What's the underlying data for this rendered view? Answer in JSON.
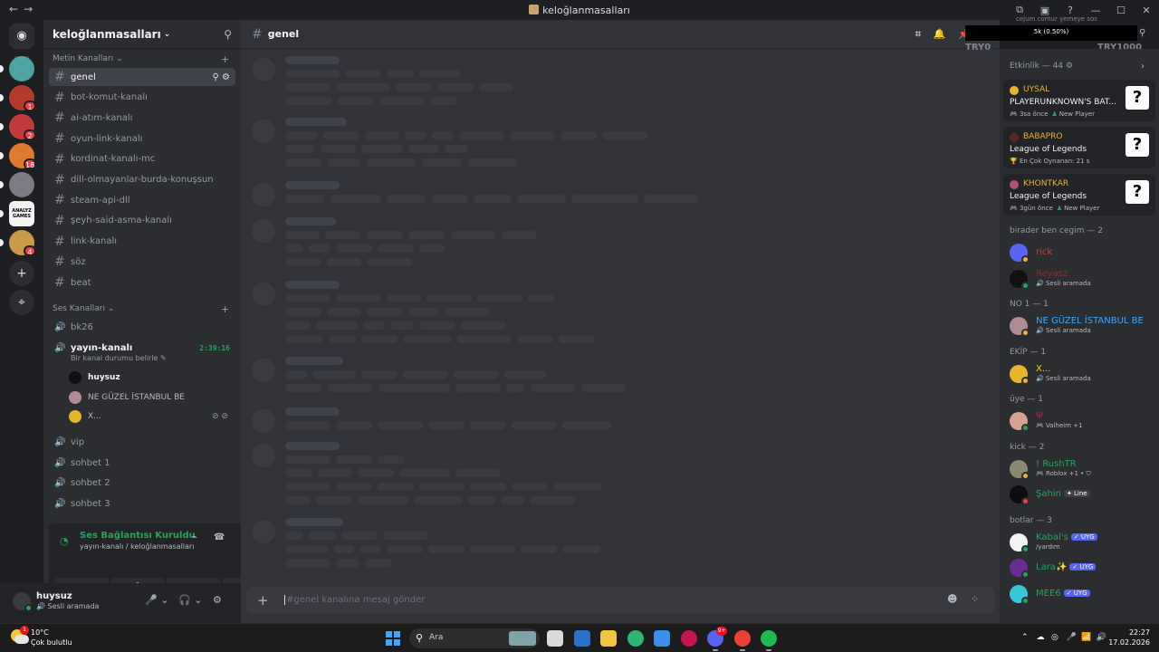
{
  "window": {
    "title": "keloğlanmasalları",
    "nav_back": "←",
    "nav_forward": "→",
    "icons": [
      "inbox-icon",
      "screen-share-icon",
      "help-icon",
      "minimize-icon",
      "maximize-icon",
      "close-icon"
    ],
    "icon_glyphs": [
      "⧉",
      "▣",
      "?",
      "—",
      "☐",
      "✕"
    ]
  },
  "guilds": {
    "home_icon": "discord-logo-icon",
    "home_glyph": "◉",
    "items": [
      {
        "name": "server-1",
        "color": "#4fa3a0",
        "badge": ""
      },
      {
        "name": "server-2",
        "color": "#b23b2c",
        "badge": "1"
      },
      {
        "name": "server-3",
        "color": "#c23a3a",
        "badge": "2"
      },
      {
        "name": "server-4",
        "color": "#e07a2f",
        "badge": "18"
      },
      {
        "name": "server-5",
        "color": "#7c7c84",
        "badge": ""
      },
      {
        "name": "server-6",
        "color": "#f2f2f2",
        "badge": ""
      },
      {
        "name": "server-7",
        "color": "#c99a47",
        "badge": "4"
      }
    ],
    "sixth_label": "ANALYZ GAMES",
    "add_glyph": "+",
    "explore_glyph": "⌖"
  },
  "server": {
    "name": "keloğlanmasalları",
    "chevron": "⌄",
    "add_person_glyph": "⚲"
  },
  "channels": {
    "text_category": "Metin Kanalları",
    "text_category_chev": "⌄",
    "cat_plus": "+",
    "text": [
      "genel",
      "bot-komut-kanalı",
      "ai-atım-kanalı",
      "oyun-link-kanalı",
      "kordinat-kanalı-mc",
      "dill-olmayanlar-burda-konuşsun",
      "steam-api-dll",
      "şeyh-said-asma-kanalı",
      "link-kanalı",
      "söz",
      "beat"
    ],
    "active_tools": "⚲ ⚙",
    "voice_category": "Ses Kanalları",
    "voice_category_chev": "⌄",
    "voice_top": [
      "bk26"
    ],
    "active_voice": {
      "name": "yayın-kanalı",
      "timer": "2:39:16",
      "status": "Bir kanal durumu belirle ✎"
    },
    "voice_users": [
      {
        "name": "huysuz",
        "color": "#101010",
        "bold": true,
        "mute": ""
      },
      {
        "name": "NE GÜZEL İSTANBUL BE",
        "color": "#b08a94",
        "bold": false,
        "mute": ""
      },
      {
        "name": "X...",
        "color": "#e8b52a",
        "bold": false,
        "mute": "⊘ ⊘"
      }
    ],
    "voice_bottom": [
      "vip",
      "sohbet 1",
      "sohbet 2",
      "sohbet 3"
    ]
  },
  "voice_panel": {
    "signal_glyph": "◔",
    "title": "Ses Bağlantısı Kuruldu",
    "subtitle": "yayın-kanalı / keloğlanmasalları",
    "noise_glyph": "⌁",
    "hangup_glyph": "☎",
    "buttons": [
      "⊘",
      "⇪",
      "⁘",
      "✺"
    ]
  },
  "user_panel": {
    "name": "huysuz",
    "status": "🔊 Sesli aramada",
    "mic_glyph": "🎤 ⌄",
    "headset_glyph": "🎧 ⌄",
    "settings_glyph": "⚙"
  },
  "chat": {
    "channel": "genel",
    "header_icons": "⌗ 🔔 📌",
    "placeholder": "#genel kanalına mesaj gönder",
    "plus": "+",
    "emoji_glyph": "☻",
    "apps_glyph": "⁘"
  },
  "overlay": {
    "top_text": "cejum comur yemeye sos",
    "percent": "5k (0.50%)",
    "try_left": "TRY0",
    "try_right": "TRY1000",
    "search_glyph": "⚲"
  },
  "members": {
    "activity_header": "Etkinlik — 44 ⚙",
    "activity_arrow": "›",
    "activities": [
      {
        "name": "UYSAL",
        "dot": "#e8b52a",
        "game": "PLAYERUNKNOWN'S BAT...",
        "meta": "🎮 3sa önce",
        "extra": "New Player",
        "icon": "?"
      },
      {
        "name": "BABAPRO",
        "dot": "#5a2a2a",
        "game": "League of Legends",
        "meta": "🏆 En Çok Oynanan: 21 s",
        "extra": "",
        "icon": "?"
      },
      {
        "name": "KHONTKAR",
        "dot": "#b05070",
        "game": "League of Legends",
        "meta": "🎮 3gün önce",
        "extra": "New Player",
        "icon": "?"
      }
    ],
    "groups": [
      {
        "header": "birader ben cegim — 2",
        "members": [
          {
            "name": "rick",
            "color": "#d13b3b",
            "avatar": "#5865f2",
            "status": "#f0b232",
            "sub": "",
            "tag": ""
          },
          {
            "name": "Reyasz",
            "color": "#8f2a2a",
            "avatar": "#111111",
            "status": "#23a55a",
            "sub": "🔊 Sesli aramada",
            "tag": ""
          }
        ]
      },
      {
        "header": "NO 1 — 1",
        "members": [
          {
            "name": "NE GÜZEL İSTANBUL BE",
            "color": "#3ea6ff",
            "avatar": "#b08a94",
            "status": "#f0b232",
            "sub": "🔊 Sesli aramada",
            "tag": ""
          }
        ]
      },
      {
        "header": "EKİP — 1",
        "members": [
          {
            "name": "X...",
            "color": "#f0d000",
            "avatar": "#e8b52a",
            "status": "#f0b232",
            "sub": "🔊 Sesli aramada",
            "tag": ""
          }
        ]
      },
      {
        "header": "üye — 1",
        "members": [
          {
            "name": "Ψ",
            "color": "#c2185b",
            "avatar": "#d8a090",
            "status": "#23a55a",
            "sub": "🎮 Valheim +1",
            "tag": ""
          }
        ]
      },
      {
        "header": "kick — 2",
        "members": [
          {
            "name": "! RushTR",
            "color": "#23a55a",
            "avatar": "#8a8a70",
            "status": "#f0b232",
            "sub": "🎮 Roblox +1 • ⛉",
            "tag": ""
          },
          {
            "name": "Şahin",
            "color": "#23a55a",
            "avatar": "#0d0d0d",
            "status": "#f23f43",
            "sub": "",
            "tag": "✦ Line"
          }
        ]
      },
      {
        "header": "botlar — 3",
        "members": [
          {
            "name": "Kabal's",
            "color": "#23a55a",
            "avatar": "#f2f2f2",
            "status": "#23a55a",
            "sub": "/yardım",
            "tag": "✓ UYG"
          },
          {
            "name": "Lara✨",
            "color": "#23a55a",
            "avatar": "#6a2c91",
            "status": "#23a55a",
            "sub": "",
            "tag": "✓ UYG"
          },
          {
            "name": "MEE6",
            "color": "#23a55a",
            "avatar": "#38c7d9",
            "status": "#23a55a",
            "sub": "",
            "tag": "✓ UYG"
          }
        ]
      }
    ]
  },
  "taskbar": {
    "weather_badge": "1",
    "temp": "10°C",
    "condition": "Çok bulutlu",
    "search_glyph": "⚲",
    "search_label": "Ara",
    "apps": [
      {
        "name": "task-view-icon",
        "color": "#d9d9d9",
        "active": false,
        "badge": ""
      },
      {
        "name": "mail-app-icon",
        "color": "#2a71c9",
        "active": false,
        "badge": ""
      },
      {
        "name": "file-explorer-icon",
        "color": "#f4c542",
        "active": false,
        "badge": ""
      },
      {
        "name": "edge-browser-icon",
        "color": "#2bb673",
        "active": false,
        "badge": ""
      },
      {
        "name": "microsoft-store-icon",
        "color": "#3b8eea",
        "active": false,
        "badge": ""
      },
      {
        "name": "opera-browser-icon",
        "color": "#c4174d",
        "active": false,
        "badge": ""
      },
      {
        "name": "discord-app-icon",
        "color": "#5865f2",
        "active": true,
        "badge": "9+"
      },
      {
        "name": "chrome-browser-icon",
        "color": "#ea4335",
        "active": true,
        "badge": ""
      },
      {
        "name": "spotify-app-icon",
        "color": "#1db954",
        "active": true,
        "badge": ""
      }
    ],
    "tray": [
      "⌃",
      "☁",
      "◎",
      "🎤",
      "📶",
      "🔊"
    ],
    "time": "22:27",
    "date": "17.02.2026"
  }
}
